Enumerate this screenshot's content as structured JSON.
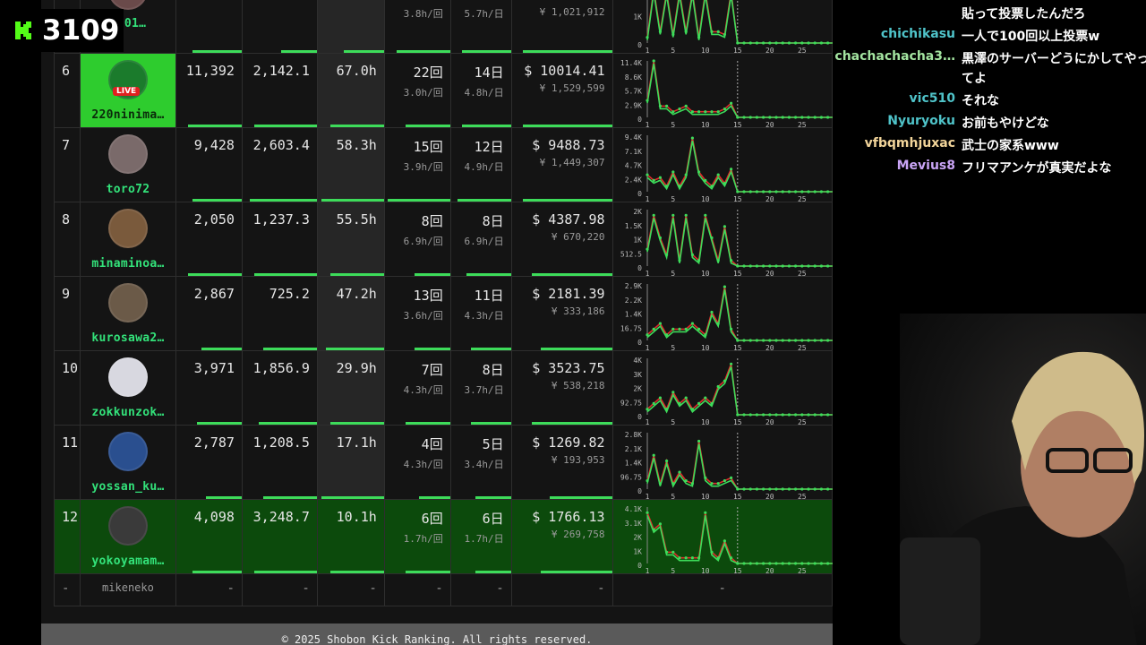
{
  "viewer_badge": {
    "count": "3109"
  },
  "top_row": {
    "user": "_101…",
    "d_sub": "3.8h/回",
    "e_sub": "5.7h/日",
    "f_sub": "¥ 1,021,912"
  },
  "rows": [
    {
      "rank": "6",
      "user": "220ninima…",
      "live": "LIVE",
      "a": "11,392",
      "b": "2,142.1",
      "c": "67.0h",
      "d": "22回",
      "d_sub": "3.0h/回",
      "e": "14日",
      "e_sub": "4.8h/日",
      "f": "$ 10014.41",
      "f_sub": "¥ 1,529,599",
      "y_ticks": [
        "11.4K",
        "8.6K",
        "5.7K",
        "2.9K",
        "0"
      ],
      "icon": "user-avatar-icon"
    },
    {
      "rank": "7",
      "user": "toro72",
      "a": "9,428",
      "b": "2,603.4",
      "c": "58.3h",
      "d": "15回",
      "d_sub": "3.9h/回",
      "e": "12日",
      "e_sub": "4.9h/日",
      "f": "$ 9488.73",
      "f_sub": "¥ 1,449,307",
      "y_ticks": [
        "9.4K",
        "7.1K",
        "4.7K",
        "2.4K",
        "0"
      ],
      "icon": "user-avatar-icon"
    },
    {
      "rank": "8",
      "user": "minaminoa…",
      "a": "2,050",
      "b": "1,237.3",
      "c": "55.5h",
      "d": "8回",
      "d_sub": "6.9h/回",
      "e": "8日",
      "e_sub": "6.9h/日",
      "f": "$ 4387.98",
      "f_sub": "¥ 670,220",
      "y_ticks": [
        "2K",
        "1.5K",
        "1K",
        "512.5",
        "0"
      ],
      "icon": "user-avatar-icon"
    },
    {
      "rank": "9",
      "user": "kurosawa2…",
      "a": "2,867",
      "b": "725.2",
      "c": "47.2h",
      "d": "13回",
      "d_sub": "3.6h/回",
      "e": "11日",
      "e_sub": "4.3h/日",
      "f": "$ 2181.39",
      "f_sub": "¥ 333,186",
      "y_ticks": [
        "2.9K",
        "2.2K",
        "1.4K",
        "16.75",
        "0"
      ],
      "icon": "user-avatar-icon"
    },
    {
      "rank": "10",
      "user": "zokkunzok…",
      "a": "3,971",
      "b": "1,856.9",
      "c": "29.9h",
      "d": "7回",
      "d_sub": "4.3h/回",
      "e": "8日",
      "e_sub": "3.7h/日",
      "f": "$ 3523.75",
      "f_sub": "¥ 538,218",
      "y_ticks": [
        "4K",
        "3K",
        "2K",
        "92.75",
        "0"
      ],
      "icon": "user-avatar-icon"
    },
    {
      "rank": "11",
      "user": "yossan_ku…",
      "a": "2,787",
      "b": "1,208.5",
      "c": "17.1h",
      "d": "4回",
      "d_sub": "4.3h/回",
      "e": "5日",
      "e_sub": "3.4h/日",
      "f": "$ 1269.82",
      "f_sub": "¥ 193,953",
      "y_ticks": [
        "2.8K",
        "2.1K",
        "1.4K",
        "96.75",
        "0"
      ],
      "icon": "user-avatar-icon"
    },
    {
      "rank": "12",
      "user": "yokoyamam…",
      "a": "4,098",
      "b": "3,248.7",
      "c": "10.1h",
      "d": "6回",
      "d_sub": "1.7h/回",
      "e": "6日",
      "e_sub": "1.7h/日",
      "f": "$ 1766.13",
      "f_sub": "¥ 269,758",
      "y_ticks": [
        "4.1K",
        "3.1K",
        "2K",
        "1K",
        "0"
      ],
      "icon": "user-avatar-icon",
      "highlight": true
    }
  ],
  "x_ticks": [
    "1",
    "5",
    "10",
    "15",
    "20",
    "25"
  ],
  "empty_row": {
    "rank": "-",
    "user": "mikeneko",
    "dash": "-"
  },
  "footer": "© 2025 Shobon Kick Ranking. All rights reserved.",
  "chat": [
    {
      "user": "",
      "text": "貼って投票したんだろ",
      "color": "#ffffff"
    },
    {
      "user": "chichikasu",
      "text": "一人で100回以上投票w",
      "color": "#4fc3c9"
    },
    {
      "user": "chachachacha3…",
      "text": "黒澤のサーバーどうにかしてやってよ",
      "color": "#a3e4a0"
    },
    {
      "user": "vic510",
      "text": "それな",
      "color": "#4fc3c9"
    },
    {
      "user": "Nyuryoku",
      "text": "お前もやけどな",
      "color": "#4fc3c9"
    },
    {
      "user": "vfbqmhjuxac",
      "text": "武士の家系www",
      "color": "#f1d49a"
    },
    {
      "user": "Mevius8",
      "text": "フリマアンケが真実だよな",
      "color": "#c9a4f5"
    }
  ],
  "colors": {
    "accent": "#33e27a",
    "kick_green": "#53fc18",
    "bar": "#3ddc5a",
    "series_red": "#e02b2b",
    "series_green": "#3ddc5a"
  }
}
